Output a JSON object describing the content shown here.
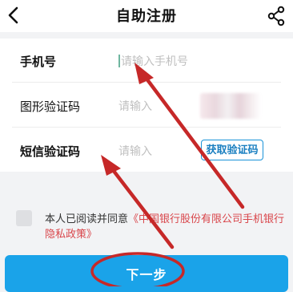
{
  "header": {
    "title": "自助注册",
    "back_icon": "chevron-left-icon",
    "share_icon": "share-icon"
  },
  "form": {
    "rows": [
      {
        "label": "手机号",
        "placeholder": "请输入手机号",
        "has_cursor": true
      },
      {
        "label": "图形验证码",
        "placeholder": "请输入",
        "captcha": "blurred-captcha-image"
      },
      {
        "label": "短信验证码",
        "placeholder": "请输入",
        "button_label": "获取验证码"
      }
    ]
  },
  "agreement": {
    "text": "本人已阅读并同意",
    "link": "《中国银行股份有限公司手机银行隐私政策》",
    "checked": false
  },
  "next_button": {
    "label": "下一步"
  },
  "colors": {
    "accent": "#1aa3e9",
    "link": "#d9464b",
    "annotation": "#c62828"
  }
}
